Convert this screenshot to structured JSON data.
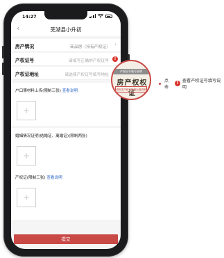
{
  "status_bar": {
    "time": "14:27"
  },
  "nav": {
    "back": "‹",
    "title": "芜湖县小升初"
  },
  "form": {
    "property": {
      "label": "房产情况",
      "value": "商品房（持有产权证）",
      "arrow": "›"
    },
    "cert_no": {
      "label": "产权证号",
      "placeholder": "请填写正确的产权证号",
      "help": "!"
    },
    "address": {
      "label": "产权证地址",
      "placeholder": "请选择产权证号填写地址"
    }
  },
  "sections": {
    "household": {
      "title": "户口簿材料上传(限制三张)",
      "link": "查看说明",
      "add": "+"
    },
    "marriage": {
      "title": "婚姻情况证明(结婚证、离婚证)(限制两张)",
      "add": "+"
    },
    "property_cert": {
      "title": "产权证(限制三张)",
      "link": "查看说明",
      "add": "+"
    }
  },
  "submit_label": "提交",
  "zoom": {
    "band": "产权证号填写说明",
    "big": "房产权权证",
    "stamp": "填写本产权证号码为准说明"
  },
  "callout": {
    "prefix": "点击",
    "badge": "!",
    "text": "查看产权证号填写说明"
  },
  "colors": {
    "accent": "#c94946",
    "link": "#2b67c6",
    "help_badge": "#d9342b"
  }
}
